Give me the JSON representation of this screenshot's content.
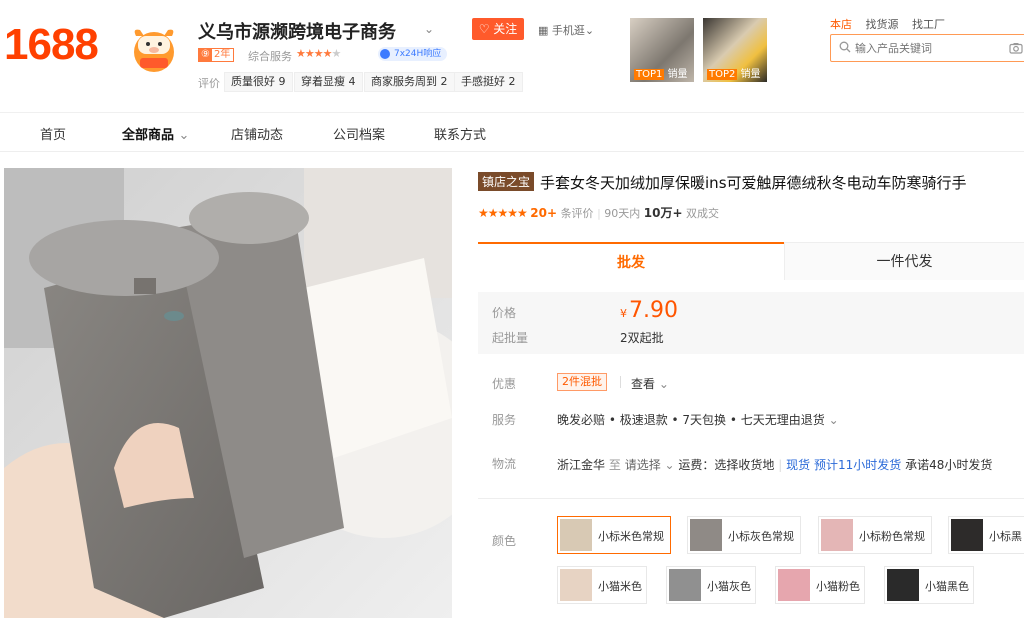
{
  "header": {
    "logo": "1688",
    "shop_name": "义乌市源濒跨境电子商务",
    "follow_label": "关注",
    "mobile_label": "手机逛",
    "year_badge": "2年",
    "service_label": "综合服务",
    "service_stars": 4,
    "response_badge": "7x24H响应",
    "review_label": "评价",
    "review_tags": [
      "质量很好 9",
      "穿着显瘦 4",
      "商家服务周到 2",
      "手感挺好 2"
    ],
    "top_products": [
      {
        "rank": "TOP1",
        "label": "销量"
      },
      {
        "rank": "TOP2",
        "label": "销量"
      }
    ],
    "search_tabs": [
      "本店",
      "找货源",
      "找工厂"
    ],
    "search_placeholder": "输入产品关键词"
  },
  "nav": {
    "items": [
      "首页",
      "全部商品",
      "店铺动态",
      "公司档案",
      "联系方式"
    ]
  },
  "product": {
    "shop_badge": "镇店之宝",
    "title": "手套女冬天加绒加厚保暖ins可爱触屏德绒秋冬电动车防寒骑行手",
    "reviews_count": "20+",
    "reviews_label": "条评价",
    "sales_period": "90天内",
    "sales_count": "10万+",
    "sales_label": "双成交",
    "tabs": [
      "批发",
      "一件代发"
    ],
    "price_label": "价格",
    "price_currency": "¥",
    "price": "7.90",
    "moq_label": "起批量",
    "moq": "2双起批",
    "promo_label": "优惠",
    "promo_badge": "2件混批",
    "promo_view": "查看",
    "service_label": "服务",
    "service_text": "晚发必赔 • 极速退款 • 7天包换 • 七天无理由退货",
    "logistics_label": "物流",
    "origin": "浙江金华",
    "to_label": "至",
    "destination": "请选择",
    "freight": "运费：选择收货地",
    "stock": "现货",
    "ship_estimate": "预计11小时发货",
    "promise": "承诺48小时发货",
    "color_label": "颜色",
    "colors": [
      {
        "label": "小标米色常规",
        "swatch": "#d8c9b4"
      },
      {
        "label": "小标灰色常规",
        "swatch": "#8f8a86"
      },
      {
        "label": "小标粉色常规",
        "swatch": "#e4b6b6"
      },
      {
        "label": "小标黑",
        "swatch": "#2d2b2a"
      },
      {
        "label": "小猫米色",
        "swatch": "#e7d3c3"
      },
      {
        "label": "小猫灰色",
        "swatch": "#909090"
      },
      {
        "label": "小猫粉色",
        "swatch": "#e6a6ae"
      },
      {
        "label": "小猫黑色",
        "swatch": "#2a2a2a"
      }
    ]
  },
  "colors": {
    "brand": "#ff4000",
    "accent": "#ff6a00",
    "link": "#2b6ad8"
  }
}
